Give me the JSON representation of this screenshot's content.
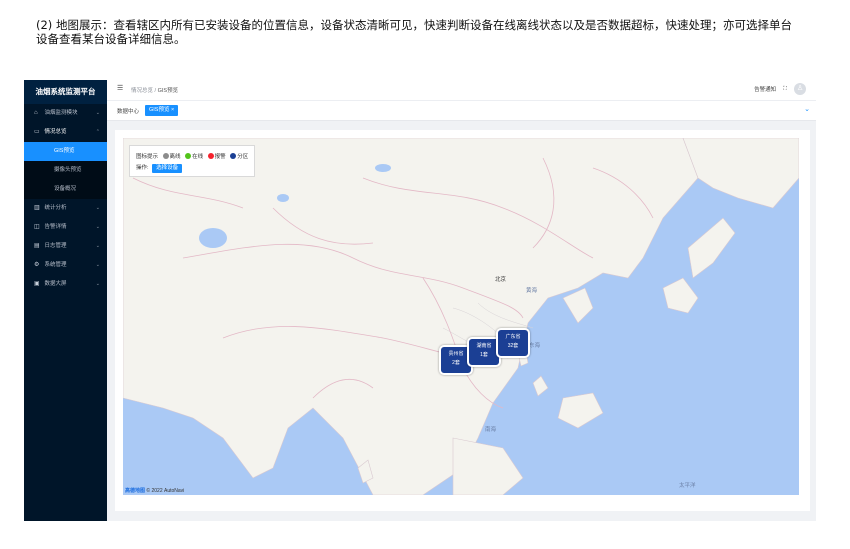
{
  "doc": {
    "paragraph": "(2) 地图展示：查看辖区内所有已安装设备的位置信息，设备状态清晰可见，快速判断设备在线离线状态以及是否数据超标，快速处理；亦可选择单台设备查看某台设备详细信息。"
  },
  "app": {
    "brand": "油烟系统监测平台",
    "menu": [
      {
        "icon": "⌂",
        "label": "油烟监测模块",
        "chev": "⌄"
      },
      {
        "icon": "▭",
        "label": "情况总览",
        "chev": "⌃"
      }
    ],
    "submenu": [
      {
        "label": "GIS预览"
      },
      {
        "label": "摄像头预览"
      },
      {
        "label": "设备概况"
      }
    ],
    "menu2": [
      {
        "icon": "▥",
        "label": "统计分析",
        "chev": "⌄"
      },
      {
        "icon": "◫",
        "label": "告警详情",
        "chev": "⌄"
      },
      {
        "icon": "▤",
        "label": "日志管理",
        "chev": "⌄"
      },
      {
        "icon": "⚙",
        "label": "系统管理",
        "chev": "⌄"
      },
      {
        "icon": "▣",
        "label": "数据大屏",
        "chev": "⌄"
      }
    ]
  },
  "header": {
    "hamburger": "☰",
    "breadcrumb_parent": "情况总览",
    "breadcrumb_sep": "/",
    "breadcrumb_current": "GIS预览",
    "notice": "告警通知",
    "fullscreen": "⛶",
    "avatar": "♙"
  },
  "tags": {
    "home": "数据中心",
    "active": "GIS预览 ×",
    "chev": "⌄"
  },
  "legend": {
    "title": "图标提示",
    "items": [
      {
        "label": "离线",
        "color": "#8c8c8c"
      },
      {
        "label": "在线",
        "color": "#52c41a"
      },
      {
        "label": "报警",
        "color": "#f5222d"
      },
      {
        "label": "分区",
        "color": "#1b3f94"
      }
    ],
    "action_label": "操作:",
    "action_button": "选择设备"
  },
  "markers": [
    {
      "name": "贵州省",
      "count": "2套"
    },
    {
      "name": "湖南省",
      "count": "1套"
    },
    {
      "name": "广东省",
      "count": "32套"
    }
  ],
  "map_labels": {
    "beijing": "北京",
    "yellow_sea": "黄海",
    "east_sea": "东海",
    "south_sea": "南海",
    "pacific": "太平洋"
  },
  "attribution": {
    "logo": "高德地图",
    "text": "© 2022 AutoNavi"
  },
  "colors": {
    "sidebar": "#001529",
    "accent": "#1890ff",
    "sea": "#aac9f5",
    "land": "#f4f3ee",
    "marker": "#1b3f94"
  }
}
